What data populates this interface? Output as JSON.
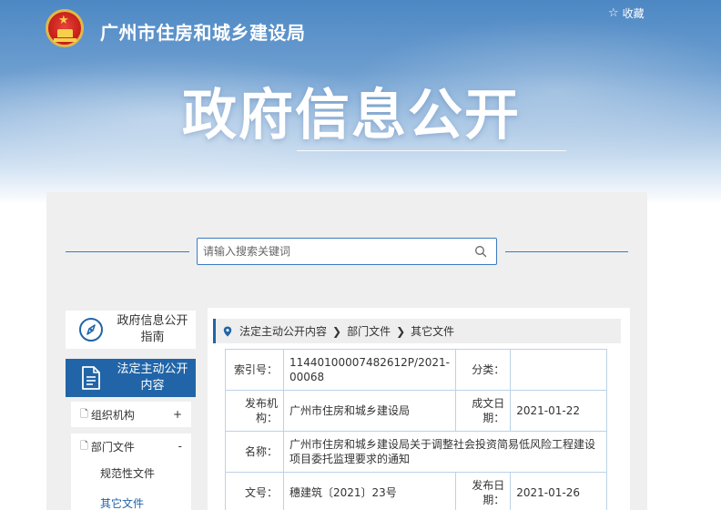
{
  "header": {
    "site_title": "广州市住房和城乡建设局",
    "favorite_label": "收藏",
    "page_title": "政府信息公开"
  },
  "search": {
    "placeholder": "请输入搜索关键词"
  },
  "sidebar": {
    "guide_label": "政府信息公开指南",
    "active_label": "法定主动公开内容",
    "org_label": "组织机构",
    "org_sign": "+",
    "dept_label": "部门文件",
    "dept_sign": "-",
    "sub_norm": "规范性文件",
    "sub_other": "其它文件"
  },
  "breadcrumb": {
    "items": [
      "法定主动公开内容",
      "部门文件",
      "其它文件"
    ]
  },
  "info": {
    "index_key": "索引号：",
    "index_value": "11440100007482612P/2021-00068",
    "category_key": "分类：",
    "category_value": "",
    "issuer_key": "发布机构：",
    "issuer_value": "广州市住房和城乡建设局",
    "created_key": "成文日期：",
    "created_value": "2021-01-22",
    "name_key": "名称：",
    "name_value": "广州市住房和城乡建设局关于调整社会投资简易低风险工程建设项目委托监理要求的通知",
    "docno_key": "文号：",
    "docno_value": "穗建筑〔2021〕23号",
    "published_key": "发布日期：",
    "published_value": "2021-01-26"
  },
  "colors": {
    "accent": "#2165a8",
    "border": "#bcd2e8",
    "panel": "#efefef"
  }
}
